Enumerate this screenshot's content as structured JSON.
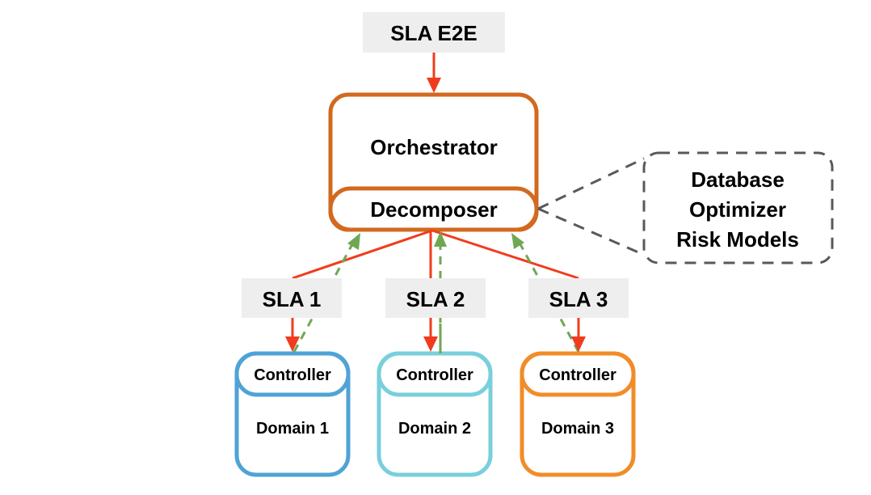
{
  "diagram": {
    "sla_e2e": "SLA E2E",
    "orchestrator": "Orchestrator",
    "decomposer": "Decomposer",
    "callout": {
      "lines": [
        "Database",
        "Optimizer",
        "Risk Models"
      ]
    },
    "slas": [
      "SLA 1",
      "SLA 2",
      "SLA 3"
    ],
    "domains": [
      {
        "controller": "Controller",
        "name": "Domain 1",
        "color": "#4fa3d6"
      },
      {
        "controller": "Controller",
        "name": "Domain 2",
        "color": "#79cfdc"
      },
      {
        "controller": "Controller",
        "name": "Domain 3",
        "color": "#f28c28"
      }
    ],
    "colors": {
      "orchestrator": "#d2691e",
      "request_arrow": "#f03c1e",
      "feedback_arrow": "#6fa853",
      "callout": "#595959",
      "label_bg": "#eeeeee"
    }
  }
}
